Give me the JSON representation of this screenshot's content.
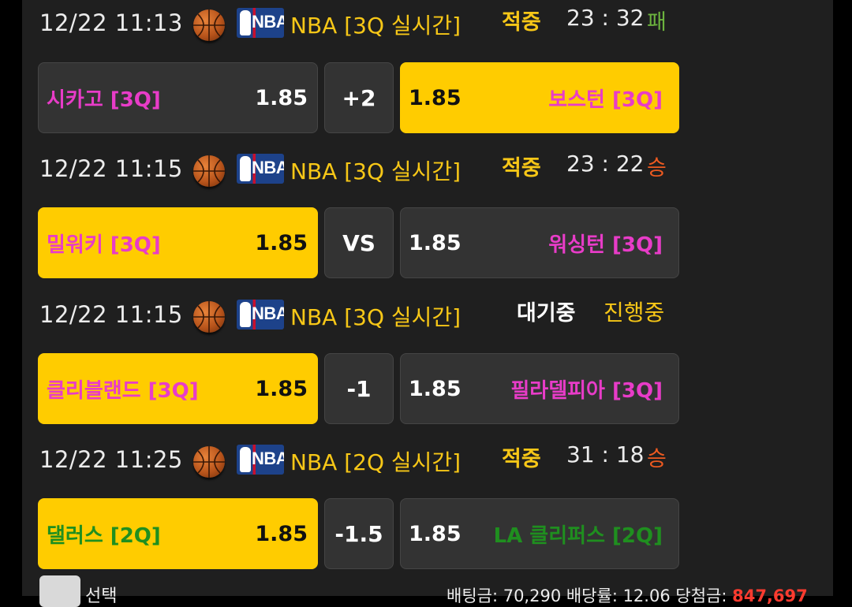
{
  "colors": {
    "accent_yellow": "#ffcc00",
    "league_yellow": "#f7c717",
    "team_magenta": "#e83cc8",
    "team_green": "#1f8f1f",
    "result_win": "#ee5a20",
    "result_lose": "#6cb33e",
    "payout_red": "#ff3b2f"
  },
  "matches": [
    {
      "time": "12/22 11:13",
      "league": "NBA [3Q 실시간]",
      "status": "적중",
      "score": "23 : 32",
      "result": "패",
      "result_color": "#6cb33e",
      "home": {
        "name": "시카고 [3Q]",
        "odds": "1.85",
        "selected": false,
        "color": "#e83cc8"
      },
      "handicap": "+2",
      "away": {
        "name": "보스턴 [3Q]",
        "odds": "1.85",
        "selected": true,
        "color": "#e83cc8"
      }
    },
    {
      "time": "12/22 11:15",
      "league": "NBA [3Q 실시간]",
      "status": "적중",
      "score": "23 : 22",
      "result": "승",
      "result_color": "#ee5a20",
      "home": {
        "name": "밀워키 [3Q]",
        "odds": "1.85",
        "selected": true,
        "color": "#e83cc8"
      },
      "handicap": "VS",
      "away": {
        "name": "워싱턴 [3Q]",
        "odds": "1.85",
        "selected": false,
        "color": "#e83cc8"
      }
    },
    {
      "time": "12/22 11:15",
      "league": "NBA [3Q 실시간]",
      "status": "대기중",
      "in_progress": "진행중",
      "home": {
        "name": "클리블랜드 [3Q]",
        "odds": "1.85",
        "selected": true,
        "color": "#e83cc8"
      },
      "handicap": "-1",
      "away": {
        "name": "필라델피아 [3Q]",
        "odds": "1.85",
        "selected": false,
        "color": "#e83cc8"
      }
    },
    {
      "time": "12/22 11:25",
      "league": "NBA [2Q 실시간]",
      "status": "적중",
      "score": "31 : 18",
      "result": "승",
      "result_color": "#ee5a20",
      "home": {
        "name": "댈러스 [2Q]",
        "odds": "1.85",
        "selected": true,
        "color": "#1f8f1f"
      },
      "handicap": "-1.5",
      "away": {
        "name": "LA 클리퍼스 [2Q]",
        "odds": "1.85",
        "selected": false,
        "color": "#1f8f1f"
      }
    }
  ],
  "footer": {
    "select_label": "선택",
    "summary_prefix": "배팅금: 70,290  배당률: 12.06  당첨금: ",
    "payout": "847,697"
  }
}
